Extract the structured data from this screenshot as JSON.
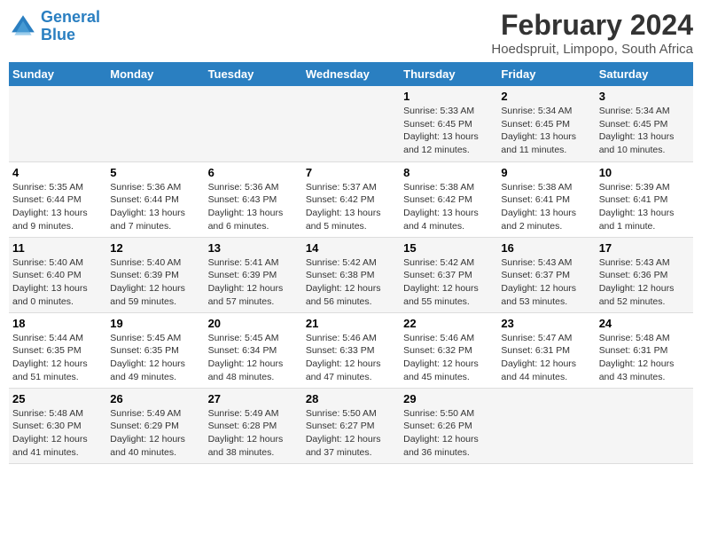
{
  "header": {
    "logo_line1": "General",
    "logo_line2": "Blue",
    "main_title": "February 2024",
    "subtitle": "Hoedspruit, Limpopo, South Africa"
  },
  "days_of_week": [
    "Sunday",
    "Monday",
    "Tuesday",
    "Wednesday",
    "Thursday",
    "Friday",
    "Saturday"
  ],
  "weeks": [
    [
      {
        "num": "",
        "info": ""
      },
      {
        "num": "",
        "info": ""
      },
      {
        "num": "",
        "info": ""
      },
      {
        "num": "",
        "info": ""
      },
      {
        "num": "1",
        "info": "Sunrise: 5:33 AM\nSunset: 6:45 PM\nDaylight: 13 hours\nand 12 minutes."
      },
      {
        "num": "2",
        "info": "Sunrise: 5:34 AM\nSunset: 6:45 PM\nDaylight: 13 hours\nand 11 minutes."
      },
      {
        "num": "3",
        "info": "Sunrise: 5:34 AM\nSunset: 6:45 PM\nDaylight: 13 hours\nand 10 minutes."
      }
    ],
    [
      {
        "num": "4",
        "info": "Sunrise: 5:35 AM\nSunset: 6:44 PM\nDaylight: 13 hours\nand 9 minutes."
      },
      {
        "num": "5",
        "info": "Sunrise: 5:36 AM\nSunset: 6:44 PM\nDaylight: 13 hours\nand 7 minutes."
      },
      {
        "num": "6",
        "info": "Sunrise: 5:36 AM\nSunset: 6:43 PM\nDaylight: 13 hours\nand 6 minutes."
      },
      {
        "num": "7",
        "info": "Sunrise: 5:37 AM\nSunset: 6:42 PM\nDaylight: 13 hours\nand 5 minutes."
      },
      {
        "num": "8",
        "info": "Sunrise: 5:38 AM\nSunset: 6:42 PM\nDaylight: 13 hours\nand 4 minutes."
      },
      {
        "num": "9",
        "info": "Sunrise: 5:38 AM\nSunset: 6:41 PM\nDaylight: 13 hours\nand 2 minutes."
      },
      {
        "num": "10",
        "info": "Sunrise: 5:39 AM\nSunset: 6:41 PM\nDaylight: 13 hours\nand 1 minute."
      }
    ],
    [
      {
        "num": "11",
        "info": "Sunrise: 5:40 AM\nSunset: 6:40 PM\nDaylight: 13 hours\nand 0 minutes."
      },
      {
        "num": "12",
        "info": "Sunrise: 5:40 AM\nSunset: 6:39 PM\nDaylight: 12 hours\nand 59 minutes."
      },
      {
        "num": "13",
        "info": "Sunrise: 5:41 AM\nSunset: 6:39 PM\nDaylight: 12 hours\nand 57 minutes."
      },
      {
        "num": "14",
        "info": "Sunrise: 5:42 AM\nSunset: 6:38 PM\nDaylight: 12 hours\nand 56 minutes."
      },
      {
        "num": "15",
        "info": "Sunrise: 5:42 AM\nSunset: 6:37 PM\nDaylight: 12 hours\nand 55 minutes."
      },
      {
        "num": "16",
        "info": "Sunrise: 5:43 AM\nSunset: 6:37 PM\nDaylight: 12 hours\nand 53 minutes."
      },
      {
        "num": "17",
        "info": "Sunrise: 5:43 AM\nSunset: 6:36 PM\nDaylight: 12 hours\nand 52 minutes."
      }
    ],
    [
      {
        "num": "18",
        "info": "Sunrise: 5:44 AM\nSunset: 6:35 PM\nDaylight: 12 hours\nand 51 minutes."
      },
      {
        "num": "19",
        "info": "Sunrise: 5:45 AM\nSunset: 6:35 PM\nDaylight: 12 hours\nand 49 minutes."
      },
      {
        "num": "20",
        "info": "Sunrise: 5:45 AM\nSunset: 6:34 PM\nDaylight: 12 hours\nand 48 minutes."
      },
      {
        "num": "21",
        "info": "Sunrise: 5:46 AM\nSunset: 6:33 PM\nDaylight: 12 hours\nand 47 minutes."
      },
      {
        "num": "22",
        "info": "Sunrise: 5:46 AM\nSunset: 6:32 PM\nDaylight: 12 hours\nand 45 minutes."
      },
      {
        "num": "23",
        "info": "Sunrise: 5:47 AM\nSunset: 6:31 PM\nDaylight: 12 hours\nand 44 minutes."
      },
      {
        "num": "24",
        "info": "Sunrise: 5:48 AM\nSunset: 6:31 PM\nDaylight: 12 hours\nand 43 minutes."
      }
    ],
    [
      {
        "num": "25",
        "info": "Sunrise: 5:48 AM\nSunset: 6:30 PM\nDaylight: 12 hours\nand 41 minutes."
      },
      {
        "num": "26",
        "info": "Sunrise: 5:49 AM\nSunset: 6:29 PM\nDaylight: 12 hours\nand 40 minutes."
      },
      {
        "num": "27",
        "info": "Sunrise: 5:49 AM\nSunset: 6:28 PM\nDaylight: 12 hours\nand 38 minutes."
      },
      {
        "num": "28",
        "info": "Sunrise: 5:50 AM\nSunset: 6:27 PM\nDaylight: 12 hours\nand 37 minutes."
      },
      {
        "num": "29",
        "info": "Sunrise: 5:50 AM\nSunset: 6:26 PM\nDaylight: 12 hours\nand 36 minutes."
      },
      {
        "num": "",
        "info": ""
      },
      {
        "num": "",
        "info": ""
      }
    ]
  ]
}
